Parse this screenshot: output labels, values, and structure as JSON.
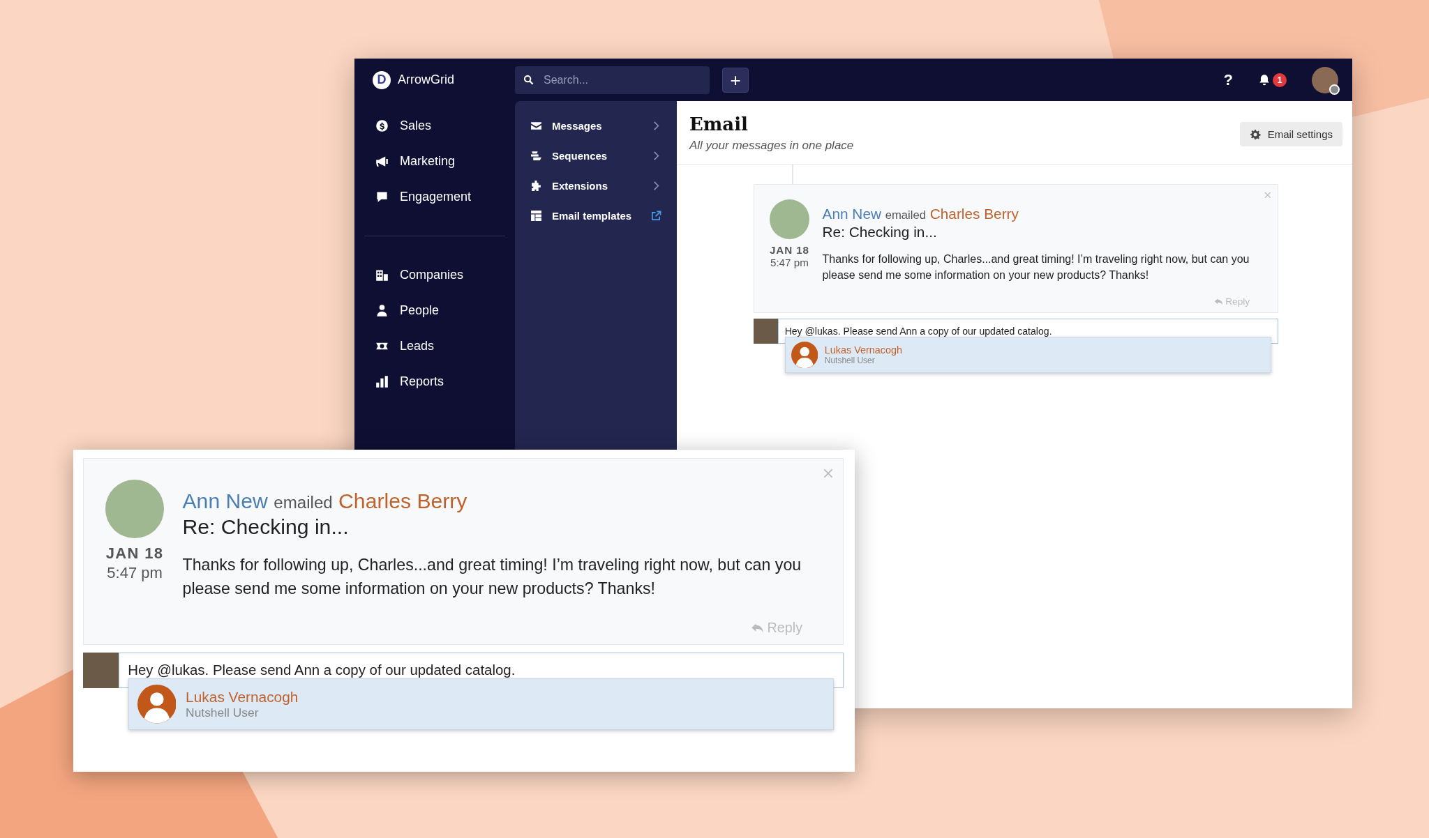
{
  "app": {
    "logo_letter": "D",
    "name": "ArrowGrid"
  },
  "topbar": {
    "search": {
      "placeholder": "Search..."
    },
    "add_label": "+",
    "help_label": "?",
    "notifications": "1"
  },
  "sidebar": {
    "primary": [
      {
        "label": "Sales"
      },
      {
        "label": "Marketing"
      },
      {
        "label": "Engagement"
      }
    ],
    "secondary": [
      {
        "label": "Companies"
      },
      {
        "label": "People"
      },
      {
        "label": "Leads"
      },
      {
        "label": "Reports"
      }
    ]
  },
  "submenu": [
    {
      "label": "Messages",
      "kind": "chevron"
    },
    {
      "label": "Sequences",
      "kind": "chevron"
    },
    {
      "label": "Extensions",
      "kind": "chevron"
    },
    {
      "label": "Email templates",
      "kind": "external"
    }
  ],
  "page": {
    "title": "Email",
    "subtitle": "All your messages in one place",
    "settings_button": "Email settings"
  },
  "email_cards": [
    {
      "sender": "Ann New",
      "verb": "emailed",
      "recipient": "Charles Berry",
      "subject": "Re: Checking in...",
      "date": "JAN 18",
      "time": "5:47 pm",
      "body": "Thanks for following up, Charles...and great timing! I’m traveling right now, but can you please send me some information on your new products? Thanks!",
      "reply": "Reply",
      "comment": "Hey @lukas. Please send Ann a copy of our updated catalog.",
      "suggestion": {
        "name": "Lukas Vernacogh",
        "role": "Nutshell User",
        "selected": true
      }
    },
    {
      "sender": "Ann New",
      "verb": "emailed",
      "recipient": "Charles Berry",
      "subject": "Re: Checking in...",
      "date": "JAN 18",
      "time": "5:47 pm",
      "body": "Thanks for following up, Charles...and great timing! I’m traveling right now, but can you please send me some information on your new products? Thanks!",
      "reply": "Reply",
      "comment": "Hey @lukas. Please send Ann a copy of our updated catalog.",
      "suggestion": {
        "name": "Lukas Vernacogh",
        "role": "Nutshell User",
        "selected": true
      }
    }
  ]
}
